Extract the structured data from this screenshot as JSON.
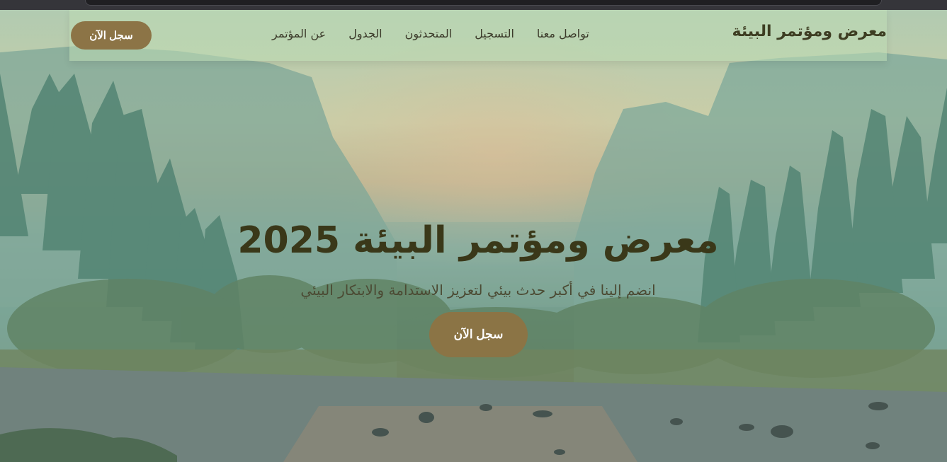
{
  "navbar": {
    "brand": "معرض ومؤتمر البيئة",
    "links": [
      {
        "label": "عن المؤتمر"
      },
      {
        "label": "الجدول"
      },
      {
        "label": "المتحدثون"
      },
      {
        "label": "التسجيل"
      },
      {
        "label": "تواصل معنا"
      }
    ],
    "cta_label": "سجل الآن"
  },
  "hero": {
    "title": "معرض ومؤتمر البيئة 2025",
    "subtitle": "انضم إلينا في أكبر حدث بيئي لتعزيز الاستدامة والابتكار البيئي",
    "cta_label": "سجل الآن"
  },
  "colors": {
    "accent": "#8c7446",
    "navbar_bg": "#bedcb4",
    "title_text": "#3a3819"
  }
}
